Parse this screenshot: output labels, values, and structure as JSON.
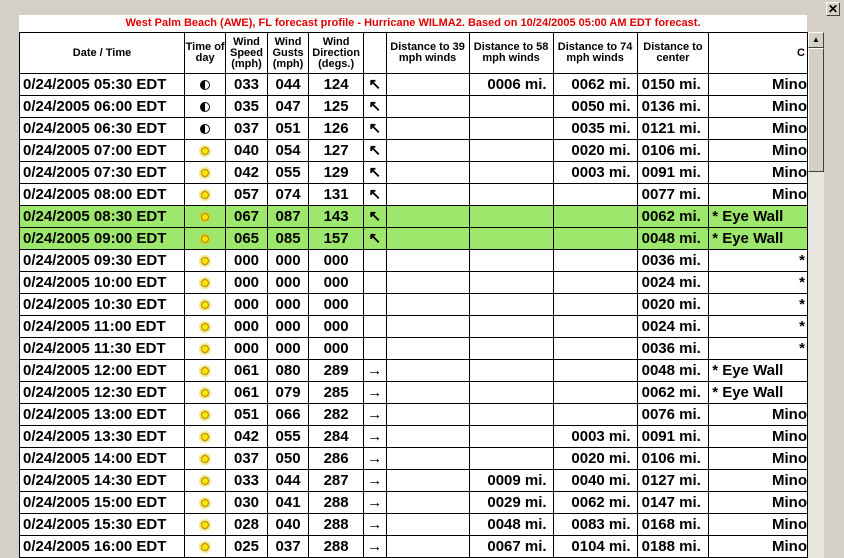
{
  "window": {
    "close_label": "✕"
  },
  "title": "West Palm Beach (AWE), FL forecast profile - Hurricane WILMA2. Based on 10/24/2005 05:00 AM EDT forecast.",
  "headers": {
    "datetime": "Date / Time",
    "time_of_day": "Time of day",
    "wind_speed": "Wind Speed (mph)",
    "wind_gusts": "Wind Gusts (mph)",
    "wind_direction": "Wind Direction (degs.)",
    "arrow": "",
    "d39": "Distance to 39 mph winds",
    "d58": "Distance to 58 mph winds",
    "d74": "Distance to 74 mph winds",
    "center": "Distance to center",
    "condition": "C"
  },
  "icons": {
    "night": "half-moon-icon",
    "day": "sun-icon"
  },
  "colors": {
    "highlight": "#9ee76d",
    "title_text": "#e00000"
  },
  "rows": [
    {
      "dt": "0/24/2005 05:30 EDT",
      "tod": "night",
      "spd": "033",
      "gst": "044",
      "dir": "124",
      "arr": "↖",
      "d39": "",
      "d58": "0006 mi.",
      "d74": "0062 mi.",
      "ctr": "0150 mi.",
      "cond": "Mino",
      "hl": false
    },
    {
      "dt": "0/24/2005 06:00 EDT",
      "tod": "night",
      "spd": "035",
      "gst": "047",
      "dir": "125",
      "arr": "↖",
      "d39": "",
      "d58": "",
      "d74": "0050 mi.",
      "ctr": "0136 mi.",
      "cond": "Mino",
      "hl": false
    },
    {
      "dt": "0/24/2005 06:30 EDT",
      "tod": "night",
      "spd": "037",
      "gst": "051",
      "dir": "126",
      "arr": "↖",
      "d39": "",
      "d58": "",
      "d74": "0035 mi.",
      "ctr": "0121 mi.",
      "cond": "Mino",
      "hl": false
    },
    {
      "dt": "0/24/2005 07:00 EDT",
      "tod": "day",
      "spd": "040",
      "gst": "054",
      "dir": "127",
      "arr": "↖",
      "d39": "",
      "d58": "",
      "d74": "0020 mi.",
      "ctr": "0106 mi.",
      "cond": "Mino",
      "hl": false
    },
    {
      "dt": "0/24/2005 07:30 EDT",
      "tod": "day",
      "spd": "042",
      "gst": "055",
      "dir": "129",
      "arr": "↖",
      "d39": "",
      "d58": "",
      "d74": "0003 mi.",
      "ctr": "0091 mi.",
      "cond": "Mino",
      "hl": false
    },
    {
      "dt": "0/24/2005 08:00 EDT",
      "tod": "day",
      "spd": "057",
      "gst": "074",
      "dir": "131",
      "arr": "↖",
      "d39": "",
      "d58": "",
      "d74": "",
      "ctr": "0077 mi.",
      "cond": "Mino",
      "hl": false
    },
    {
      "dt": "0/24/2005 08:30 EDT",
      "tod": "day",
      "spd": "067",
      "gst": "087",
      "dir": "143",
      "arr": "↖",
      "d39": "",
      "d58": "",
      "d74": "",
      "ctr": "0062 mi.",
      "cond": "* Eye Wall",
      "hl": true
    },
    {
      "dt": "0/24/2005 09:00 EDT",
      "tod": "day",
      "spd": "065",
      "gst": "085",
      "dir": "157",
      "arr": "↖",
      "d39": "",
      "d58": "",
      "d74": "",
      "ctr": "0048 mi.",
      "cond": "* Eye Wall",
      "hl": true
    },
    {
      "dt": "0/24/2005 09:30 EDT",
      "tod": "day",
      "spd": "000",
      "gst": "000",
      "dir": "000",
      "arr": "",
      "d39": "",
      "d58": "",
      "d74": "",
      "ctr": "0036 mi.",
      "cond": "*",
      "hl": false
    },
    {
      "dt": "0/24/2005 10:00 EDT",
      "tod": "day",
      "spd": "000",
      "gst": "000",
      "dir": "000",
      "arr": "",
      "d39": "",
      "d58": "",
      "d74": "",
      "ctr": "0024 mi.",
      "cond": "*",
      "hl": false
    },
    {
      "dt": "0/24/2005 10:30 EDT",
      "tod": "day",
      "spd": "000",
      "gst": "000",
      "dir": "000",
      "arr": "",
      "d39": "",
      "d58": "",
      "d74": "",
      "ctr": "0020 mi.",
      "cond": "*",
      "hl": false
    },
    {
      "dt": "0/24/2005 11:00 EDT",
      "tod": "day",
      "spd": "000",
      "gst": "000",
      "dir": "000",
      "arr": "",
      "d39": "",
      "d58": "",
      "d74": "",
      "ctr": "0024 mi.",
      "cond": "*",
      "hl": false
    },
    {
      "dt": "0/24/2005 11:30 EDT",
      "tod": "day",
      "spd": "000",
      "gst": "000",
      "dir": "000",
      "arr": "",
      "d39": "",
      "d58": "",
      "d74": "",
      "ctr": "0036 mi.",
      "cond": "*",
      "hl": false
    },
    {
      "dt": "0/24/2005 12:00 EDT",
      "tod": "day",
      "spd": "061",
      "gst": "080",
      "dir": "289",
      "arr": "→",
      "d39": "",
      "d58": "",
      "d74": "",
      "ctr": "0048 mi.",
      "cond": "* Eye Wall",
      "hl": false
    },
    {
      "dt": "0/24/2005 12:30 EDT",
      "tod": "day",
      "spd": "061",
      "gst": "079",
      "dir": "285",
      "arr": "→",
      "d39": "",
      "d58": "",
      "d74": "",
      "ctr": "0062 mi.",
      "cond": "* Eye Wall",
      "hl": false
    },
    {
      "dt": "0/24/2005 13:00 EDT",
      "tod": "day",
      "spd": "051",
      "gst": "066",
      "dir": "282",
      "arr": "→",
      "d39": "",
      "d58": "",
      "d74": "",
      "ctr": "0076 mi.",
      "cond": "Mino",
      "hl": false
    },
    {
      "dt": "0/24/2005 13:30 EDT",
      "tod": "day",
      "spd": "042",
      "gst": "055",
      "dir": "284",
      "arr": "→",
      "d39": "",
      "d58": "",
      "d74": "0003 mi.",
      "ctr": "0091 mi.",
      "cond": "Mino",
      "hl": false
    },
    {
      "dt": "0/24/2005 14:00 EDT",
      "tod": "day",
      "spd": "037",
      "gst": "050",
      "dir": "286",
      "arr": "→",
      "d39": "",
      "d58": "",
      "d74": "0020 mi.",
      "ctr": "0106 mi.",
      "cond": "Mino",
      "hl": false
    },
    {
      "dt": "0/24/2005 14:30 EDT",
      "tod": "day",
      "spd": "033",
      "gst": "044",
      "dir": "287",
      "arr": "→",
      "d39": "",
      "d58": "0009 mi.",
      "d74": "0040 mi.",
      "ctr": "0127 mi.",
      "cond": "Mino",
      "hl": false
    },
    {
      "dt": "0/24/2005 15:00 EDT",
      "tod": "day",
      "spd": "030",
      "gst": "041",
      "dir": "288",
      "arr": "→",
      "d39": "",
      "d58": "0029 mi.",
      "d74": "0062 mi.",
      "ctr": "0147 mi.",
      "cond": "Mino",
      "hl": false
    },
    {
      "dt": "0/24/2005 15:30 EDT",
      "tod": "day",
      "spd": "028",
      "gst": "040",
      "dir": "288",
      "arr": "→",
      "d39": "",
      "d58": "0048 mi.",
      "d74": "0083 mi.",
      "ctr": "0168 mi.",
      "cond": "Mino",
      "hl": false
    },
    {
      "dt": "0/24/2005 16:00 EDT",
      "tod": "day",
      "spd": "025",
      "gst": "037",
      "dir": "288",
      "arr": "→",
      "d39": "",
      "d58": "0067 mi.",
      "d74": "0104 mi.",
      "ctr": "0188 mi.",
      "cond": "Mino",
      "hl": false
    }
  ]
}
